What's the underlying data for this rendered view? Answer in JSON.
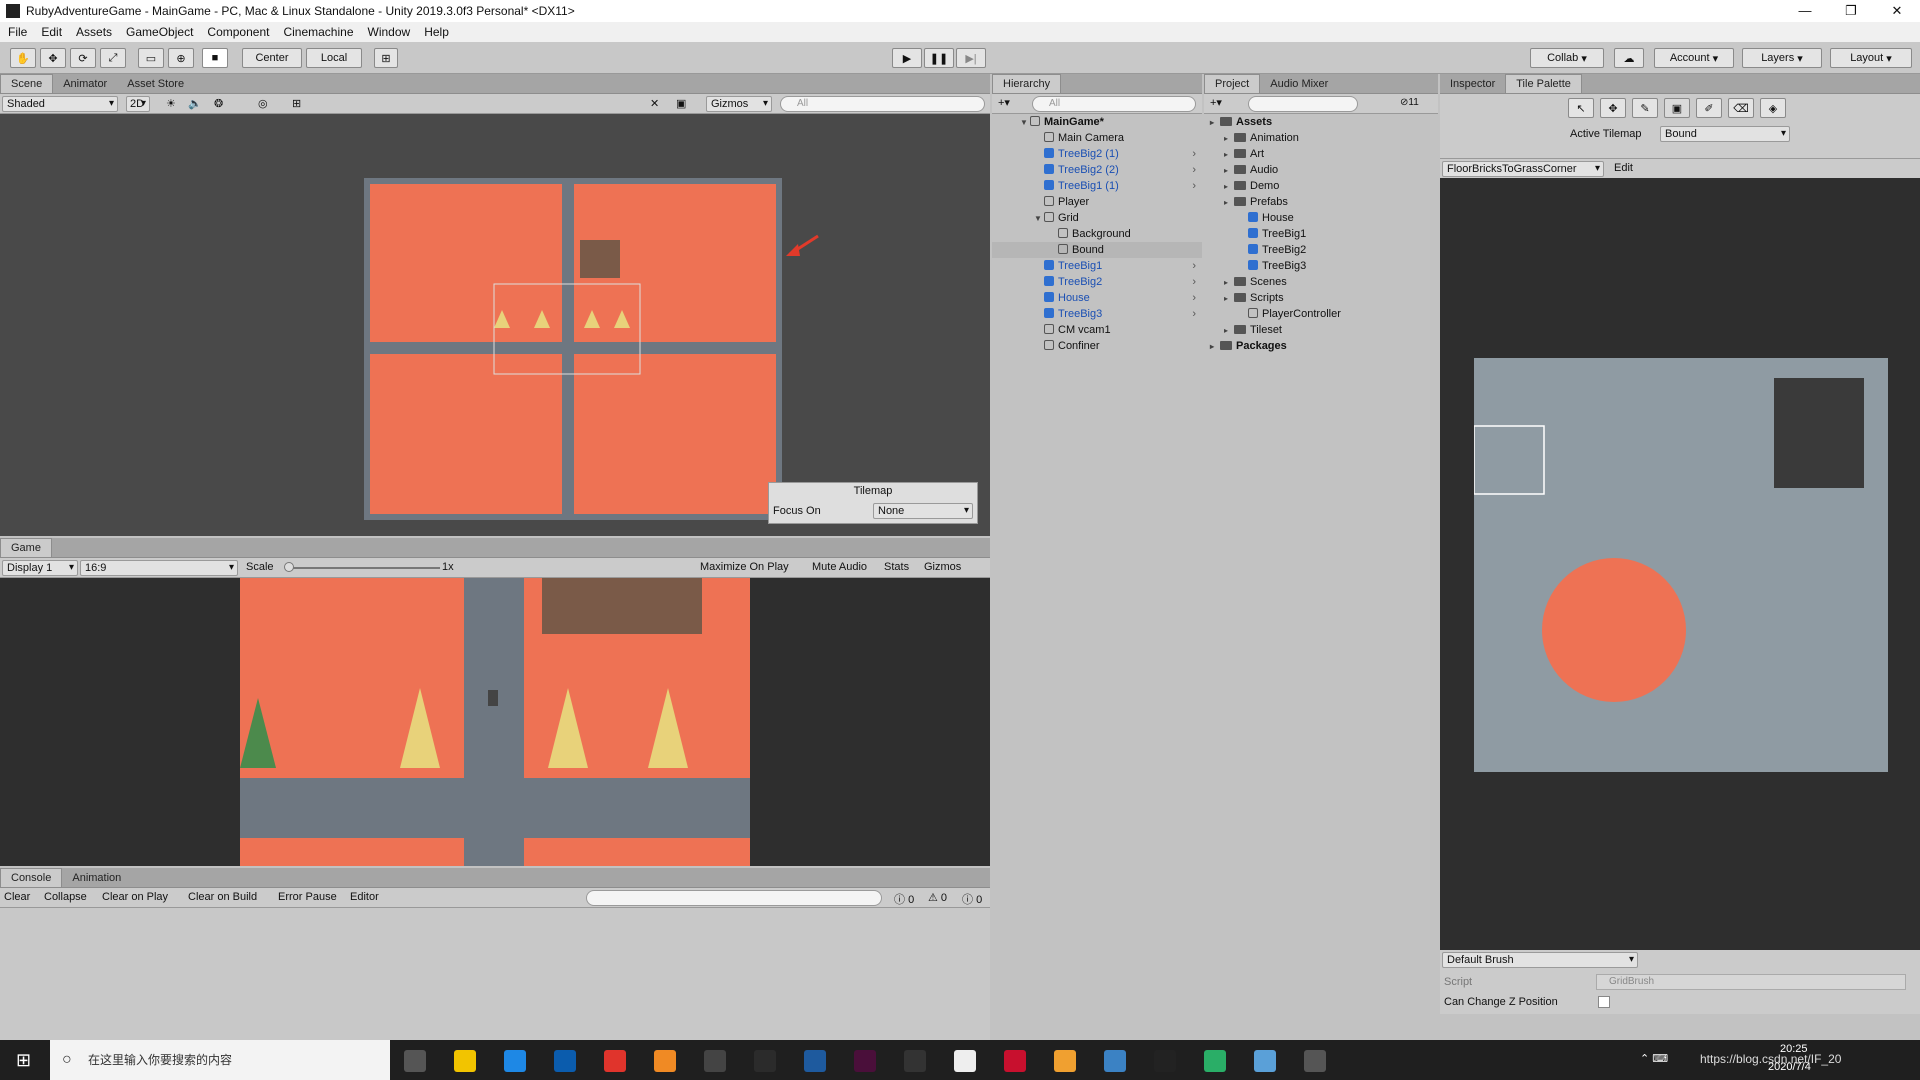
{
  "window": {
    "title": "RubyAdventureGame - MainGame - PC, Mac & Linux Standalone - Unity 2019.3.0f3 Personal* <DX11>",
    "controls": [
      "—",
      "❐",
      "✕"
    ]
  },
  "menu": [
    "File",
    "Edit",
    "Assets",
    "GameObject",
    "Component",
    "Cinemachine",
    "Window",
    "Help"
  ],
  "toolbar": {
    "pivot_center": "Center",
    "pivot_local": "Local",
    "collab": "Collab",
    "account": "Account",
    "layers": "Layers",
    "layout": "Layout"
  },
  "scene": {
    "tabs": [
      "Scene",
      "Animator",
      "Asset Store"
    ],
    "shading": "Shaded",
    "mode2d": "2D",
    "gizmos": "Gizmos",
    "search_placeholder": "All",
    "tilemap_overlay": {
      "title": "Tilemap",
      "focus_label": "Focus On",
      "focus_value": "None"
    }
  },
  "game": {
    "tab": "Game",
    "display": "Display 1",
    "aspect": "16:9",
    "scale_label": "Scale",
    "scale_value": "1x",
    "buttons": [
      "Maximize On Play",
      "Mute Audio",
      "Stats",
      "Gizmos"
    ]
  },
  "console": {
    "tabs": [
      "Console",
      "Animation"
    ],
    "buttons": [
      "Clear",
      "Collapse",
      "Clear on Play",
      "Clear on Build",
      "Error Pause",
      "Editor"
    ],
    "counts": {
      "info": "0",
      "warn": "0",
      "error": "0"
    }
  },
  "hierarchy": {
    "tab": "Hierarchy",
    "search_placeholder": "All",
    "items": [
      {
        "label": "MainGame*",
        "level": 0,
        "bold": true,
        "expanded": true,
        "blue": false
      },
      {
        "label": "Main Camera",
        "level": 1,
        "blue": false
      },
      {
        "label": "TreeBig2 (1)",
        "level": 1,
        "blue": true
      },
      {
        "label": "TreeBig2 (2)",
        "level": 1,
        "blue": true
      },
      {
        "label": "TreeBig1 (1)",
        "level": 1,
        "blue": true
      },
      {
        "label": "Player",
        "level": 1,
        "blue": false
      },
      {
        "label": "Grid",
        "level": 1,
        "blue": false,
        "expanded": true
      },
      {
        "label": "Background",
        "level": 2,
        "blue": false
      },
      {
        "label": "Bound",
        "level": 2,
        "blue": false,
        "selected": true
      },
      {
        "label": "TreeBig1",
        "level": 1,
        "blue": true
      },
      {
        "label": "TreeBig2",
        "level": 1,
        "blue": true
      },
      {
        "label": "House",
        "level": 1,
        "blue": true
      },
      {
        "label": "TreeBig3",
        "level": 1,
        "blue": true
      },
      {
        "label": "CM vcam1",
        "level": 1,
        "blue": false
      },
      {
        "label": "Confiner",
        "level": 1,
        "blue": false
      }
    ]
  },
  "project": {
    "tabs": [
      "Project",
      "Audio Mixer"
    ],
    "hidden_count": "11",
    "items": [
      {
        "label": "Assets",
        "level": 0,
        "type": "folder",
        "bold": true
      },
      {
        "label": "Animation",
        "level": 1,
        "type": "folder"
      },
      {
        "label": "Art",
        "level": 1,
        "type": "folder"
      },
      {
        "label": "Audio",
        "level": 1,
        "type": "folder"
      },
      {
        "label": "Demo",
        "level": 1,
        "type": "folder"
      },
      {
        "label": "Prefabs",
        "level": 1,
        "type": "folder"
      },
      {
        "label": "House",
        "level": 2,
        "type": "prefab"
      },
      {
        "label": "TreeBig1",
        "level": 2,
        "type": "prefab"
      },
      {
        "label": "TreeBig2",
        "level": 2,
        "type": "prefab"
      },
      {
        "label": "TreeBig3",
        "level": 2,
        "type": "prefab"
      },
      {
        "label": "Scenes",
        "level": 1,
        "type": "folder"
      },
      {
        "label": "Scripts",
        "level": 1,
        "type": "folder"
      },
      {
        "label": "PlayerController",
        "level": 2,
        "type": "script"
      },
      {
        "label": "Tileset",
        "level": 1,
        "type": "folder"
      },
      {
        "label": "Packages",
        "level": 0,
        "type": "folder",
        "bold": true
      }
    ]
  },
  "inspector": {
    "tabs": [
      "Inspector",
      "Tile Palette"
    ],
    "active_tilemap_label": "Active Tilemap",
    "active_tilemap_value": "Bound",
    "palette_name": "FloorBricksToGrassCorner",
    "edit_label": "Edit",
    "brush": "Default Brush",
    "script_label": "Script",
    "script_value": "GridBrush",
    "change_z_label": "Can Change Z Position"
  },
  "taskbar": {
    "search_placeholder": "在这里输入你要搜索的内容",
    "time": "20:25",
    "date": "2020/7/4",
    "watermark": "https://blog.csdn.net/IF_20"
  },
  "colors": {
    "ground": "#ee7254",
    "path": "#6e7781",
    "editor_bg": "#c2c2c2",
    "scene_bg": "#494949",
    "prefab_blue": "#1a4fb3",
    "palette_bg": "#2e2e2e"
  }
}
